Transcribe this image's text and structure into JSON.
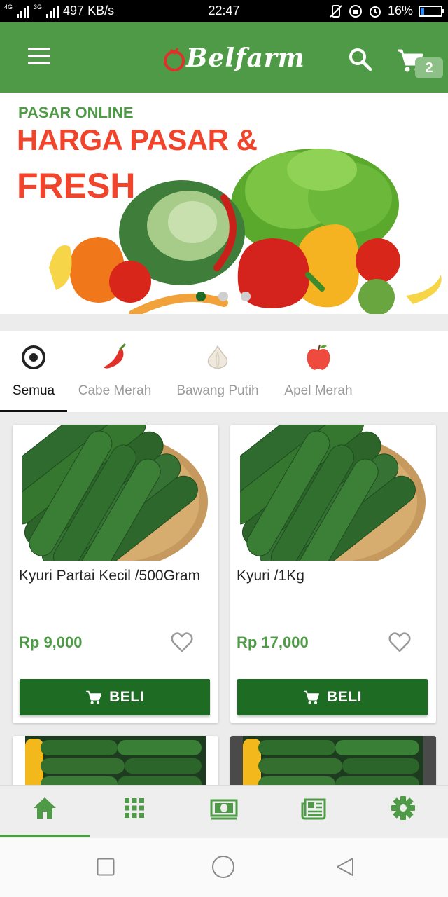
{
  "status_bar": {
    "network_left": "4G",
    "network_right": "3G",
    "speed": "497 KB/s",
    "time": "22:47",
    "battery": "16%",
    "battery_level": 0.16
  },
  "app_bar": {
    "logo_text": "Belfarm",
    "cart_count": "2"
  },
  "banner": {
    "subtitle": "PASAR ONLINE",
    "headline_1": "HARGA PASAR &",
    "headline_2": "FRESH",
    "slide_count": 3,
    "active_slide": 0
  },
  "categories": [
    {
      "label": "Semua",
      "icon": "all-icon",
      "active": true
    },
    {
      "label": "Cabe Merah",
      "icon": "chili-icon",
      "active": false
    },
    {
      "label": "Bawang Putih",
      "icon": "garlic-icon",
      "active": false
    },
    {
      "label": "Apel Merah",
      "icon": "apple-icon",
      "active": false
    }
  ],
  "products": [
    {
      "name": "Kyuri Partai Kecil /500Gram",
      "price": "Rp 9,000",
      "buy_label": "BELI"
    },
    {
      "name": "Kyuri /1Kg",
      "price": "Rp 17,000",
      "buy_label": "BELI"
    }
  ],
  "bottom_nav": [
    {
      "icon": "home-icon",
      "active": true
    },
    {
      "icon": "grid-icon",
      "active": false
    },
    {
      "icon": "money-icon",
      "active": false
    },
    {
      "icon": "news-icon",
      "active": false
    },
    {
      "icon": "settings-icon",
      "active": false
    }
  ],
  "colors": {
    "primary": "#4e9a46",
    "primary_dark": "#1e6b24",
    "accent_red": "#f0452c"
  }
}
